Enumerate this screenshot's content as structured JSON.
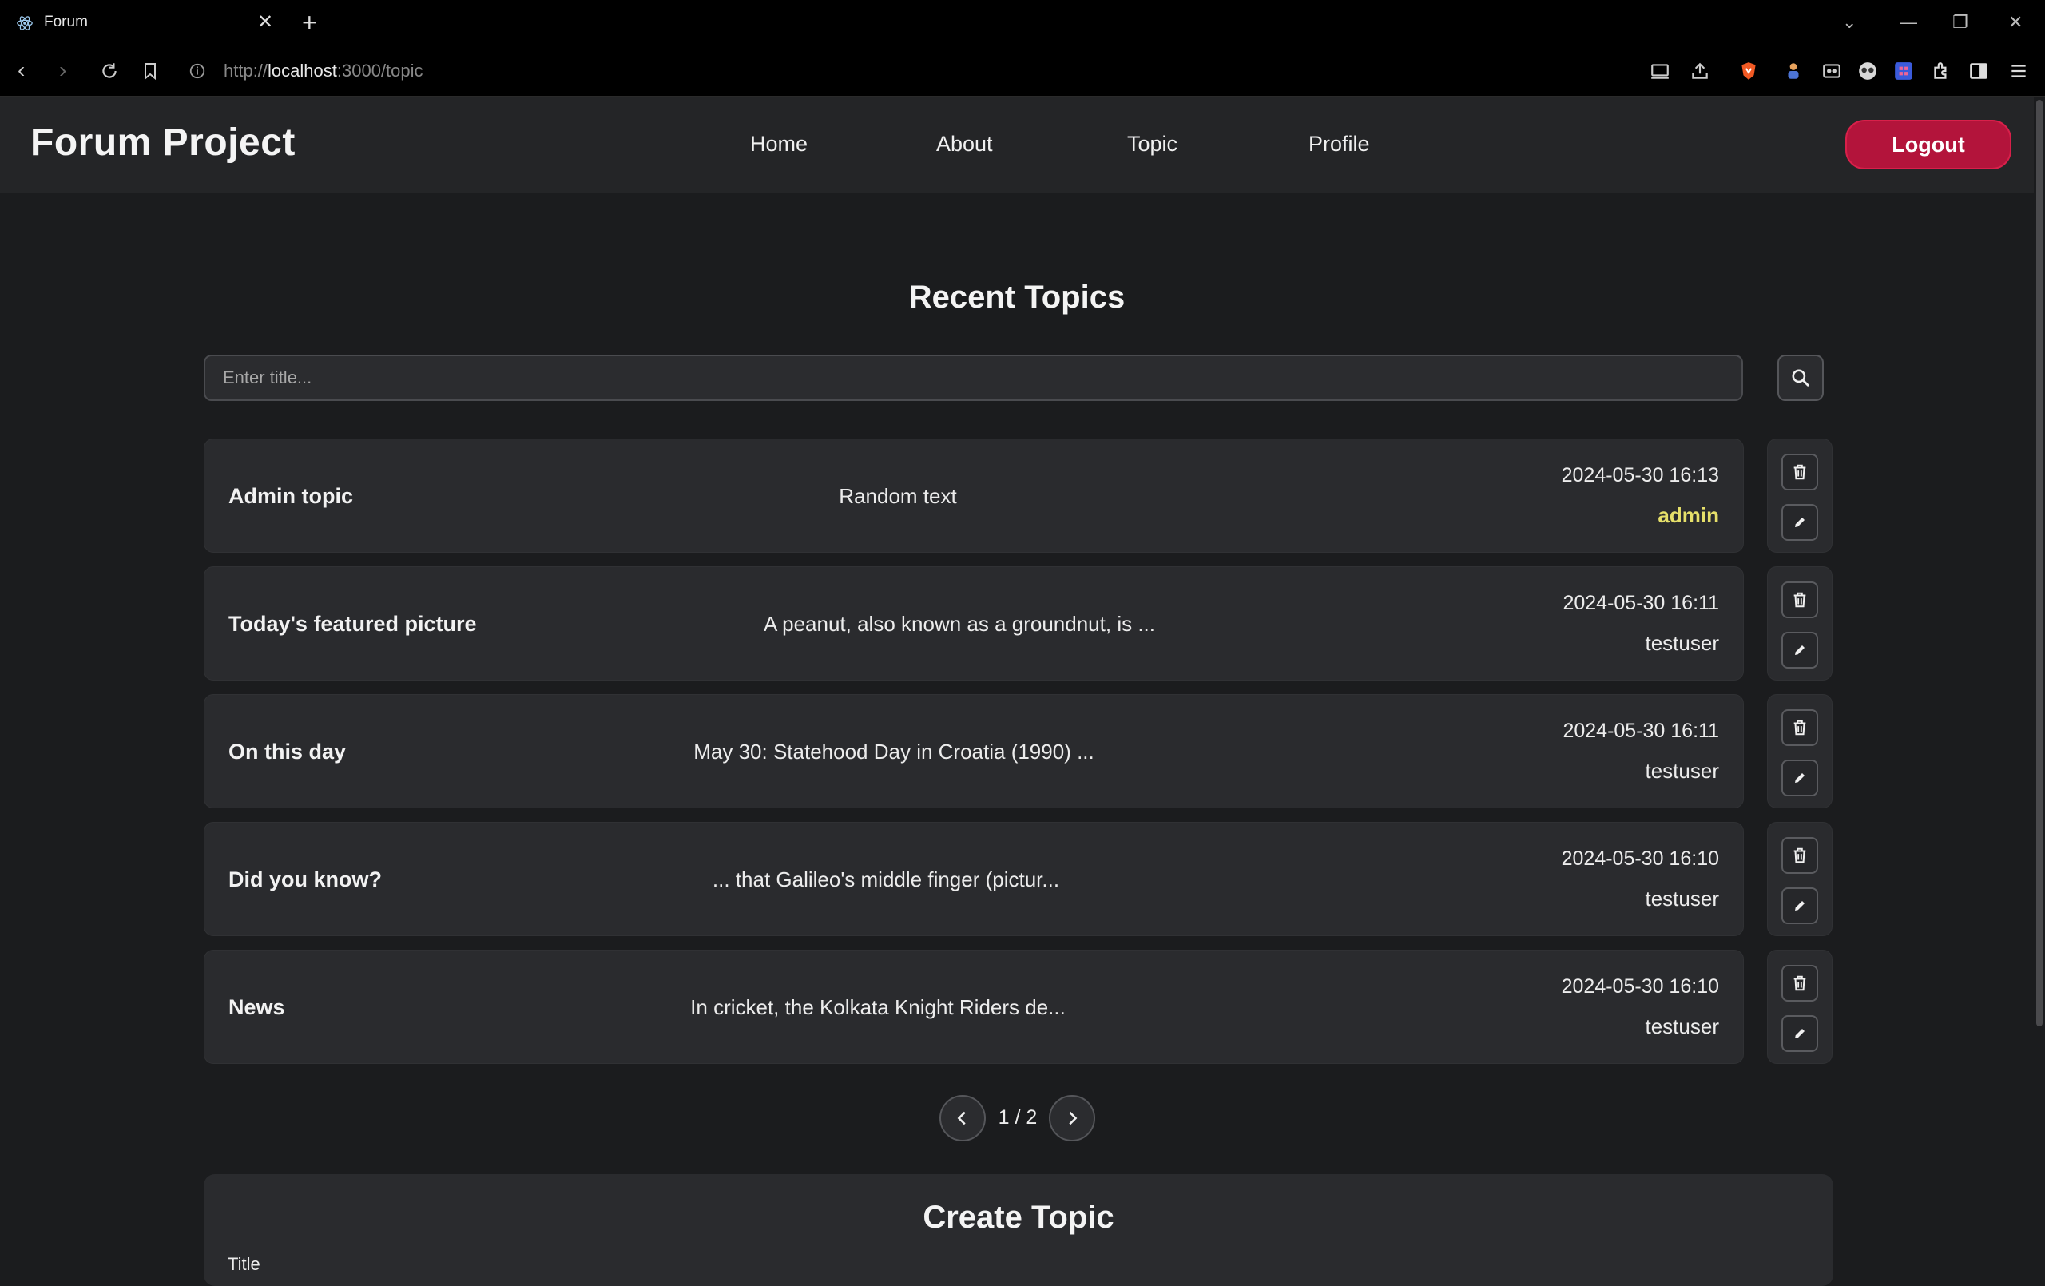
{
  "browser": {
    "tab_title": "Forum",
    "url_scheme": "http://",
    "url_host": "localhost",
    "url_rest": ":3000/topic"
  },
  "site": {
    "brand": "Forum Project",
    "nav": [
      "Home",
      "About",
      "Topic",
      "Profile"
    ],
    "logout_label": "Logout",
    "accent_color": "#b3143b",
    "admin_color": "#e6e06a"
  },
  "main": {
    "title": "Recent Topics",
    "search_placeholder": "Enter title...",
    "topics": [
      {
        "title": "Admin topic",
        "excerpt": "Random text",
        "date": "2024-05-30 16:13",
        "author": "admin",
        "is_admin": true
      },
      {
        "title": "Today's featured picture",
        "excerpt": "A peanut, also known as a groundnut, is ...",
        "date": "2024-05-30 16:11",
        "author": "testuser",
        "is_admin": false
      },
      {
        "title": "On this day",
        "excerpt": "May 30: Statehood Day in Croatia (1990) ...",
        "date": "2024-05-30 16:11",
        "author": "testuser",
        "is_admin": false
      },
      {
        "title": "Did you know?",
        "excerpt": "... that Galileo's middle finger (pictur...",
        "date": "2024-05-30 16:10",
        "author": "testuser",
        "is_admin": false
      },
      {
        "title": "News",
        "excerpt": "In cricket, the Kolkata Knight Riders de...",
        "date": "2024-05-30 16:10",
        "author": "testuser",
        "is_admin": false
      }
    ],
    "pagination": "1 / 2"
  },
  "create": {
    "title": "Create Topic",
    "title_label": "Title"
  }
}
